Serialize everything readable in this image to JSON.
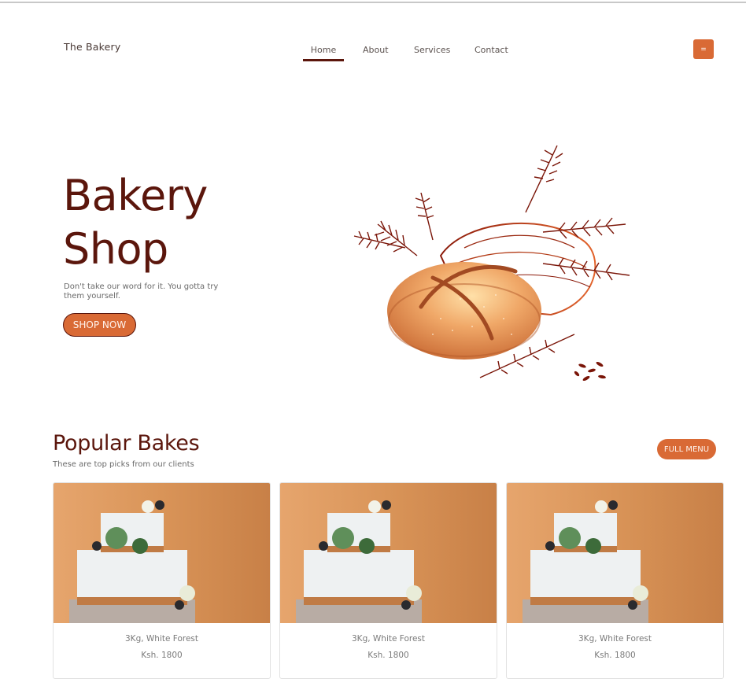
{
  "header": {
    "brand": "The Bakery",
    "nav": [
      "Home",
      "About",
      "Services",
      "Contact"
    ],
    "active_nav": "Home",
    "menu_icon": "="
  },
  "hero": {
    "title_line1": "Bakery",
    "title_line2": "Shop",
    "text": "Don't take our word for it. You gotta try them yourself.",
    "button": "SHOP NOW"
  },
  "popular": {
    "title": "Popular Bakes",
    "subtitle": "These are top picks from our clients",
    "button": "FULL MENU",
    "items": [
      {
        "name": "3Kg, White Forest",
        "price": "Ksh. 1800"
      },
      {
        "name": "3Kg, White Forest",
        "price": "Ksh. 1800"
      },
      {
        "name": "3Kg, White Forest",
        "price": "Ksh. 1800"
      }
    ]
  },
  "colors": {
    "accent": "#d96a35",
    "brand_dark": "#5b160c"
  }
}
